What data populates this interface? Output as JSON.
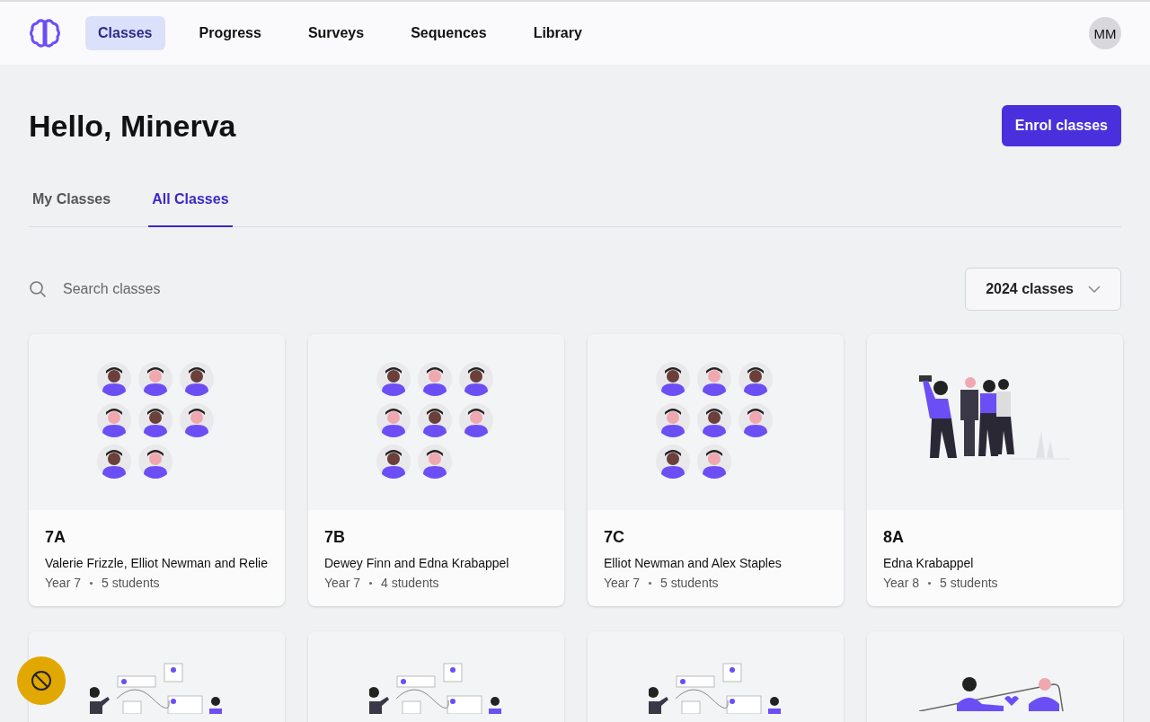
{
  "nav": {
    "items": [
      {
        "label": "Classes",
        "selected": true
      },
      {
        "label": "Progress",
        "selected": false
      },
      {
        "label": "Surveys",
        "selected": false
      },
      {
        "label": "Sequences",
        "selected": false
      },
      {
        "label": "Library",
        "selected": false
      }
    ],
    "avatar": "MM"
  },
  "greeting": "Hello, Minerva",
  "enrol_button": "Enrol classes",
  "tabs": [
    {
      "label": "My Classes",
      "selected": false
    },
    {
      "label": "All Classes",
      "selected": true
    }
  ],
  "search": {
    "placeholder": "Search classes"
  },
  "year_filter": "2024 classes",
  "cards": [
    {
      "kind": "avatars",
      "title": "7A",
      "teachers": "Valerie Frizzle, Elliot Newman and Relie",
      "year": "Year 7",
      "students": "5 students"
    },
    {
      "kind": "avatars",
      "title": "7B",
      "teachers": "Dewey Finn and Edna Krabappel",
      "year": "Year 7",
      "students": "4 students"
    },
    {
      "kind": "avatars",
      "title": "7C",
      "teachers": "Elliot Newman and Alex Staples",
      "year": "Year 7",
      "students": "5 students"
    },
    {
      "kind": "group",
      "title": "8A",
      "teachers": "Edna Krabappel",
      "year": "Year 8",
      "students": "5 students"
    },
    {
      "kind": "diagram"
    },
    {
      "kind": "diagram"
    },
    {
      "kind": "diagram"
    },
    {
      "kind": "couple"
    }
  ]
}
